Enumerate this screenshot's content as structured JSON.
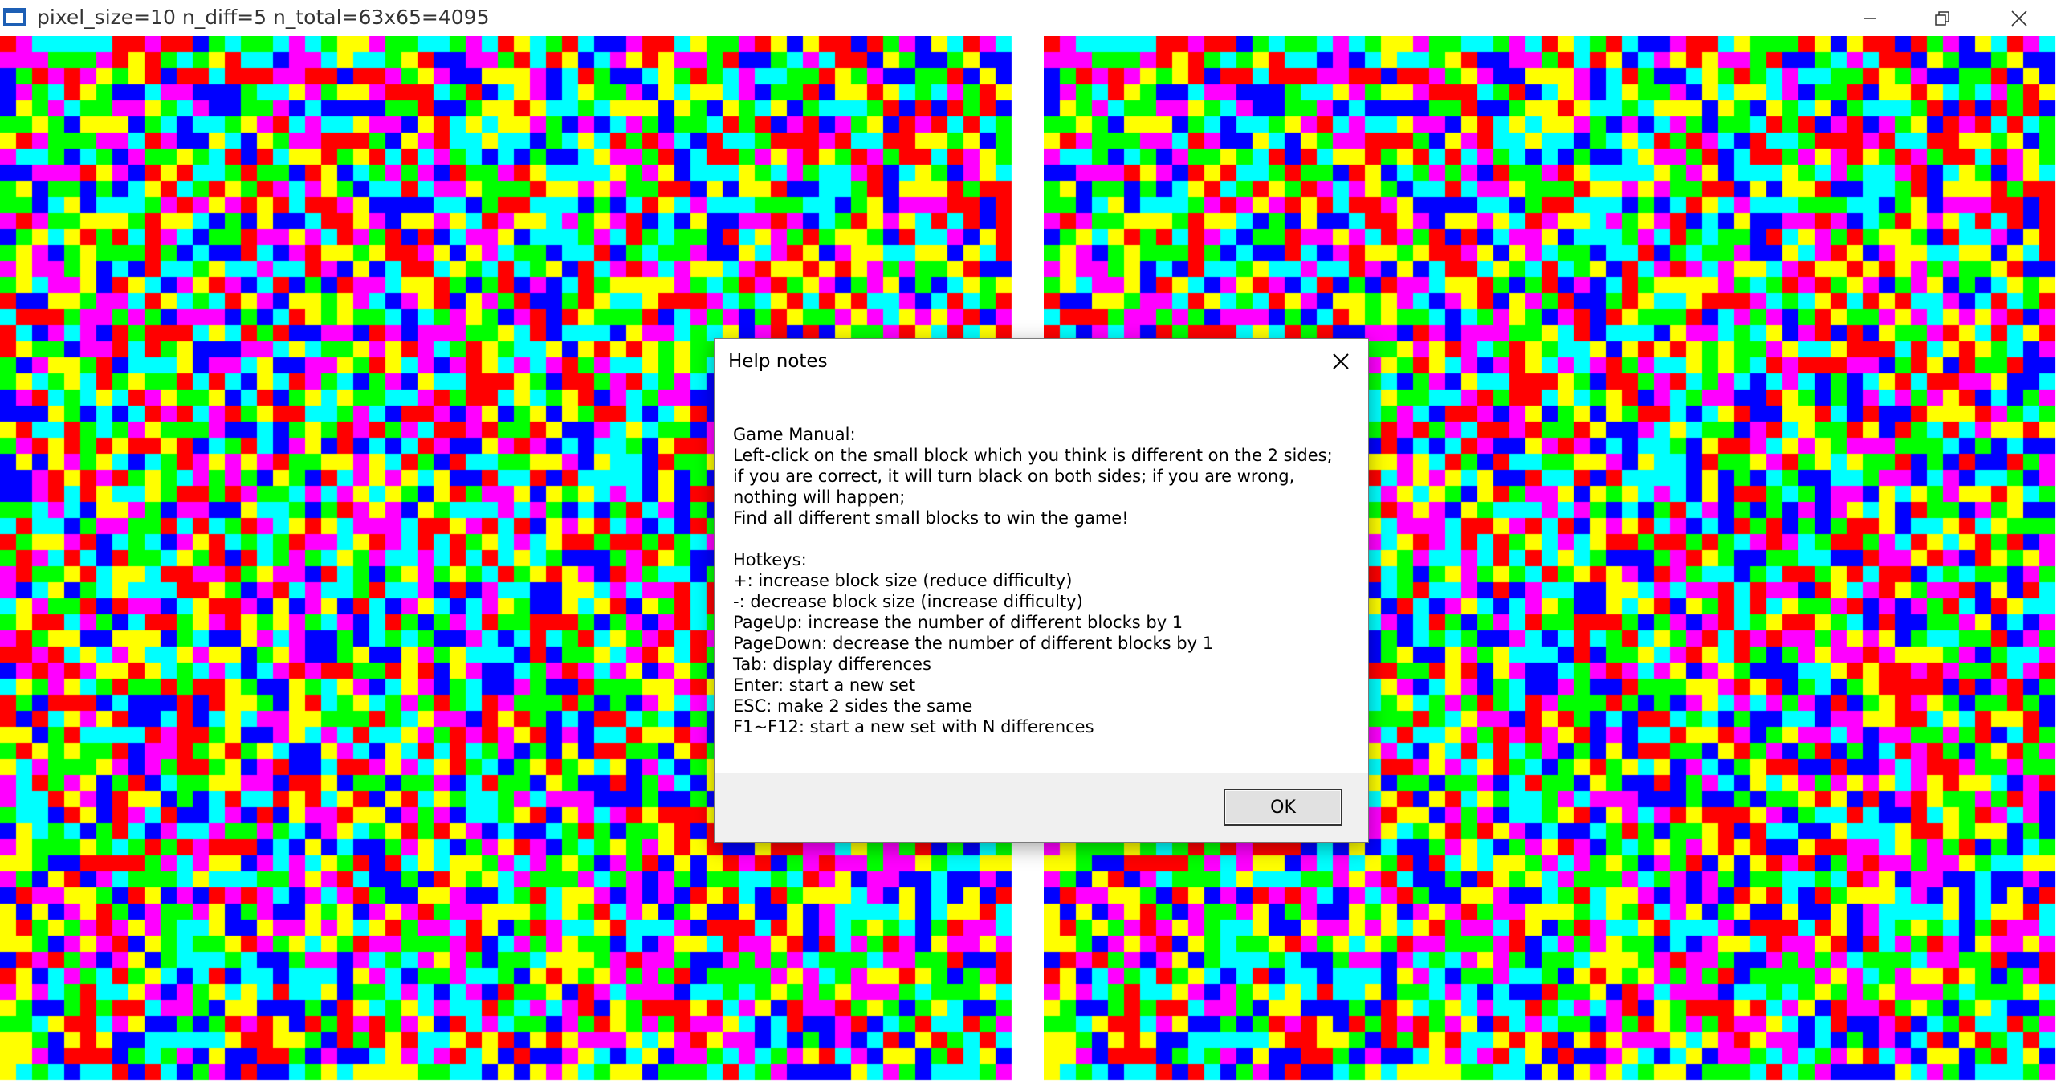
{
  "window": {
    "title": "pixel_size=10  n_diff=5  n_total=63x65=4095",
    "icon": "window-app-icon",
    "controls": [
      "minimize-icon",
      "restore-icon",
      "close-icon"
    ]
  },
  "game": {
    "pixel_size": 10,
    "n_diff": 5,
    "cols": 63,
    "rows": 65,
    "n_total": 4095,
    "palette": [
      "#ff0000",
      "#00ff00",
      "#0000ff",
      "#ffff00",
      "#ff00ff",
      "#00ffff"
    ]
  },
  "dialog": {
    "title": "Help notes",
    "lines": [
      "Game Manual:",
      "Left-click on the small block which you think is different on the 2 sides;",
      "if you are correct, it will turn black on both sides; if you are wrong,",
      "nothing will happen;",
      "Find all different small blocks to win the game!",
      "",
      "Hotkeys:",
      "+: increase block size (reduce difficulty)",
      "-: decrease block size (increase difficulty)",
      "PageUp: increase the number of different blocks by 1",
      "PageDown: decrease the number of different blocks by 1",
      "Tab: display differences",
      "Enter: start a new set",
      "ESC: make 2 sides the same",
      "F1~F12: start a new set with N differences"
    ],
    "ok_label": "OK"
  }
}
